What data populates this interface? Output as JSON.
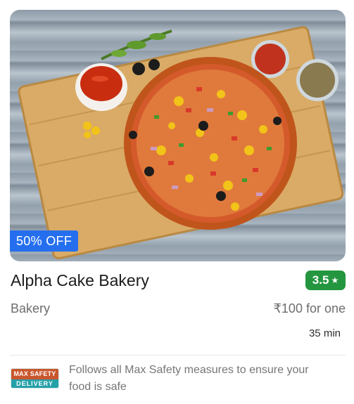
{
  "card": {
    "offer": "50% OFF",
    "restaurant_name": "Alpha Cake Bakery",
    "rating": "3.5",
    "cuisine": "Bakery",
    "price": "₹100 for one",
    "delivery_time": "35 min"
  },
  "safety": {
    "logo_top": "MAX SAFETY",
    "logo_bottom": "DELIVERY",
    "message": "Follows all Max Safety measures to ensure your food is safe"
  },
  "colors": {
    "offer_badge": "#256fef",
    "rating_badge": "#24963f",
    "logo_top": "#c9572d",
    "logo_bottom": "#25a0a8"
  }
}
